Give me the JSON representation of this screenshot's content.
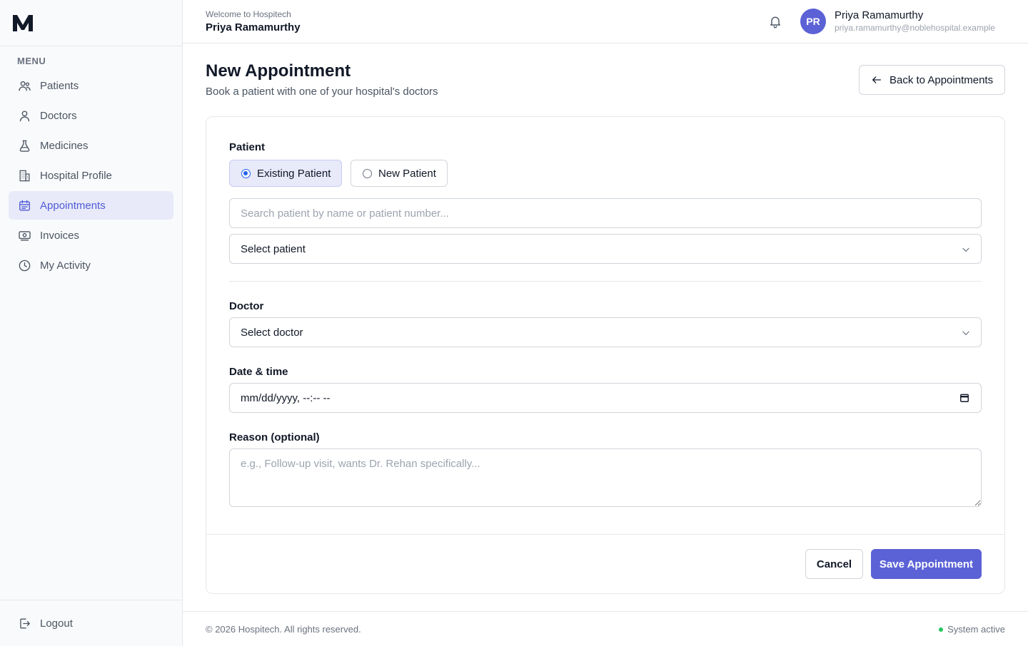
{
  "app": {
    "logo_text": "M"
  },
  "sidebar": {
    "menu_label": "MENU",
    "items": [
      {
        "label": "Patients",
        "icon": "users-icon"
      },
      {
        "label": "Doctors",
        "icon": "user-icon"
      },
      {
        "label": "Medicines",
        "icon": "flask-icon"
      },
      {
        "label": "Hospital Profile",
        "icon": "building-icon"
      },
      {
        "label": "Appointments",
        "icon": "calendar-icon",
        "active": true
      },
      {
        "label": "Invoices",
        "icon": "banknote-icon"
      },
      {
        "label": "My Activity",
        "icon": "clock-icon"
      }
    ],
    "logout_label": "Logout"
  },
  "header": {
    "welcome": "Welcome to Hospitech",
    "name": "Priya Ramamurthy",
    "avatar_initials": "PR",
    "user_name": "Priya Ramamurthy",
    "user_email": "priya.ramamurthy@noblehospital.example"
  },
  "page": {
    "title": "New Appointment",
    "subtitle": "Book a patient with one of your hospital's doctors",
    "back_label": "Back to Appointments"
  },
  "form": {
    "patient_label": "Patient",
    "existing_patient": "Existing Patient",
    "new_patient": "New Patient",
    "search_placeholder": "Search patient by name or patient number...",
    "select_patient": "Select patient",
    "doctor_label": "Doctor",
    "select_doctor": "Select doctor",
    "datetime_label": "Date & time",
    "datetime_value": "mm/dd/yyyy, --:-- --",
    "reason_label": "Reason (optional)",
    "reason_placeholder": "e.g., Follow-up visit, wants Dr. Rehan specifically...",
    "cancel_label": "Cancel",
    "save_label": "Save Appointment"
  },
  "footer": {
    "copyright": "© 2026 Hospitech. All rights reserved.",
    "status": "System active"
  },
  "colors": {
    "accent": "#5b62d6",
    "active_bg": "#e8eafa",
    "status_green": "#22c55e"
  }
}
